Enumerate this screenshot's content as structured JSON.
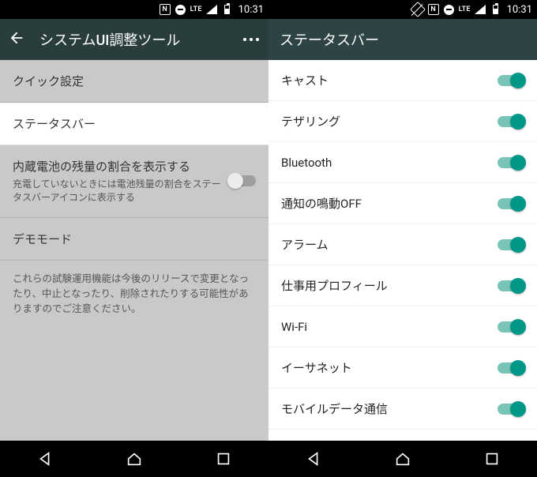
{
  "status": {
    "lte": "LTE",
    "clock": "10:31",
    "nfc": "N"
  },
  "left": {
    "appbar_title": "システムUI調整ツール",
    "rows": {
      "quick_settings": "クイック設定",
      "status_bar": "ステータスバー",
      "battery_title": "内蔵電池の残量の割合を表示する",
      "battery_sub": "充電していないときには電池残量の割合をステータスバーアイコンに表示する",
      "demo_mode": "デモモード"
    },
    "caption": "これらの試験運用機能は今後のリリースで変更となったり、中止となったり、削除されたりする可能性がありますのでご注意ください。"
  },
  "right": {
    "appbar_title": "ステータスバー",
    "items": [
      "キャスト",
      "テザリング",
      "Bluetooth",
      "通知の鳴動OFF",
      "アラーム",
      "仕事用プロフィール",
      "Wi-Fi",
      "イーサネット",
      "モバイルデータ通信"
    ]
  }
}
